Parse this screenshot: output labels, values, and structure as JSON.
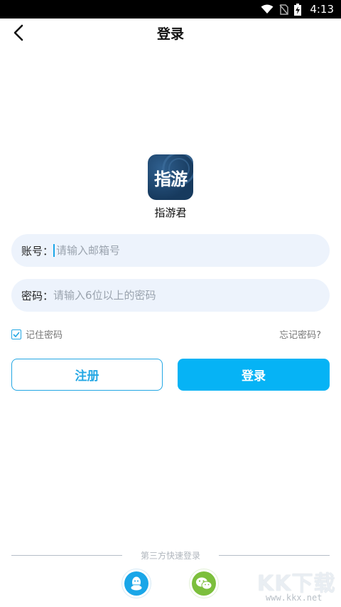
{
  "status_bar": {
    "time": "4:13",
    "icons": [
      "wifi-icon",
      "no-sim-icon",
      "battery-charging-icon"
    ]
  },
  "nav": {
    "title": "登录",
    "back_icon": "chevron-left-icon"
  },
  "app": {
    "logo_text": "指游",
    "name": "指游君"
  },
  "form": {
    "account_label": "账号：",
    "account_placeholder": "请输入邮箱号",
    "account_value": "",
    "password_label": "密码：",
    "password_placeholder": "请输入6位以上的密码",
    "password_value": "",
    "remember_label": "记住密码",
    "remember_checked": true,
    "forgot_label": "忘记密码?"
  },
  "buttons": {
    "register_label": "注册",
    "login_label": "登录"
  },
  "third_party": {
    "label": "第三方快速登录",
    "providers": [
      "qq-icon",
      "wechat-icon"
    ]
  },
  "watermark": {
    "brand": "KK下载",
    "domain": "www.kkx.net"
  },
  "colors": {
    "accent": "#06b3f5",
    "outline": "#23a7e4",
    "field_bg": "#edf3fc",
    "qq": "#1aa6e8",
    "wechat": "#7cbf3c"
  }
}
